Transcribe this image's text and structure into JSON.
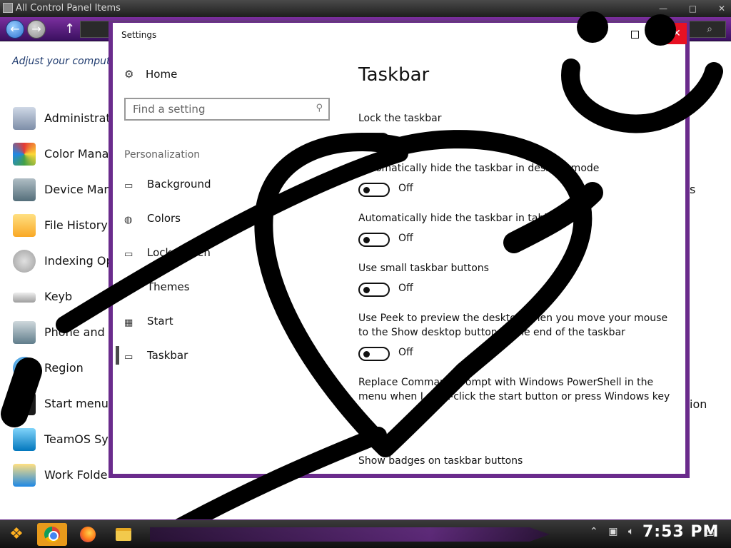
{
  "background_window": {
    "title": "All Control Panel Items",
    "heading": "Adjust your comput",
    "items": [
      {
        "label": "Administrat",
        "icon": "admin-tools-icon"
      },
      {
        "label": "Color Manag",
        "icon": "color-management-icon"
      },
      {
        "label": "Device Mana",
        "icon": "device-manager-icon"
      },
      {
        "label": "File History",
        "icon": "file-history-icon"
      },
      {
        "label": "Indexing Op",
        "icon": "indexing-icon"
      },
      {
        "label": "Keyb",
        "icon": "keyboard-icon"
      },
      {
        "label": "Phone and M",
        "icon": "phone-modem-icon"
      },
      {
        "label": "Region",
        "icon": "region-icon"
      },
      {
        "label": "Start menu",
        "icon": "start-menu-icon"
      },
      {
        "label": "TeamOS Sy",
        "icon": "teamos-icon"
      },
      {
        "label": "Work Folde",
        "icon": "work-folders-icon"
      }
    ],
    "right_fragments": [
      "s",
      "ion"
    ]
  },
  "settings": {
    "window_title": "Settings",
    "home_label": "Home",
    "search_placeholder": "Find a setting",
    "section_label": "Personalization",
    "nav": [
      {
        "label": "Background",
        "icon": "background-icon"
      },
      {
        "label": "Colors",
        "icon": "palette-icon"
      },
      {
        "label": "Lock screen",
        "icon": "lock-screen-icon"
      },
      {
        "label": "Themes",
        "icon": "themes-icon"
      },
      {
        "label": "Start",
        "icon": "start-icon"
      },
      {
        "label": "Taskbar",
        "icon": "taskbar-icon"
      }
    ],
    "page_title": "Taskbar",
    "options": [
      {
        "label": "Lock the taskbar",
        "state": ""
      },
      {
        "label": "Automatically hide the taskbar in desktop mode",
        "state": "Off"
      },
      {
        "label": "Automatically hide the taskbar in tablet mode",
        "state": "Off"
      },
      {
        "label": "Use small taskbar buttons",
        "state": "Off"
      },
      {
        "label": "Use Peek to preview the desktop when you move your mouse to the Show desktop button at the end of the taskbar",
        "state": "Off"
      },
      {
        "label": "Replace Command Prompt with Windows PowerShell in the menu when I right-click the start button or press Windows key",
        "state": ""
      },
      {
        "label": "Show badges on taskbar buttons",
        "state": ""
      }
    ]
  },
  "taskbar": {
    "time": "7:53 PM",
    "apps": [
      "chrome-icon",
      "firefox-icon",
      "file-explorer-icon"
    ]
  },
  "colors": {
    "accent": "#6a2b8c",
    "close": "#e81123",
    "active_app": "#e89a1b"
  }
}
